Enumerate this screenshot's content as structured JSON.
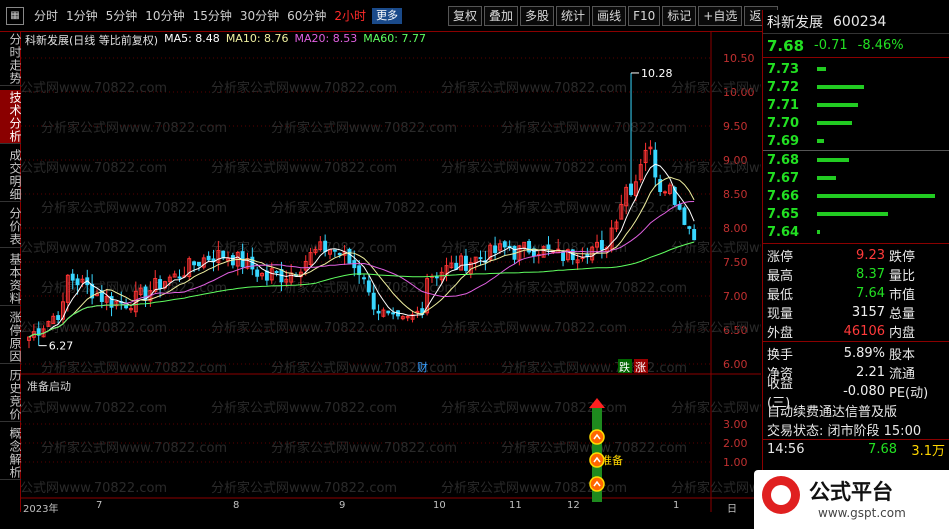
{
  "toolbar": {
    "periods": [
      "分时",
      "1分钟",
      "5分钟",
      "10分钟",
      "15分钟",
      "30分钟",
      "60分钟",
      "2小时"
    ],
    "active_period": "2小时",
    "more": "更多",
    "actions": [
      "复权",
      "叠加",
      "多股",
      "统计",
      "画线",
      "F10",
      "标记",
      "+自选",
      "返回"
    ]
  },
  "vtabs": [
    {
      "label": "分时走势",
      "active": false
    },
    {
      "label": "技术分析",
      "active": true
    },
    {
      "label": "成交明细",
      "active": false
    },
    {
      "label": "分价表",
      "active": false
    },
    {
      "label": "基本资料",
      "active": false
    },
    {
      "label": "涨停原因",
      "active": false
    },
    {
      "label": "历史竞价",
      "active": false
    },
    {
      "label": "概念解析",
      "active": false
    }
  ],
  "chart": {
    "title": "科新发展(日线 等比前复权)",
    "ma5": "MA5: 8.48",
    "ma10": "MA10: 8.76",
    "ma20": "MA20: 8.53",
    "ma60": "MA60: 7.77",
    "high_marker": "10.28",
    "low_marker": "6.27",
    "event_cai": "财",
    "event_die": "跌",
    "event_zhang": "涨",
    "indicator_name": "准备启动",
    "indicator_label": "准备",
    "watermark": "分析家公式网www.70822.com"
  },
  "axis": {
    "price_ticks": [
      "10.50",
      "10.00",
      "9.50",
      "9.00",
      "8.50",
      "8.00",
      "7.50",
      "7.00",
      "6.50",
      "6.00"
    ],
    "ind_ticks": [
      "3.00",
      "2.00",
      "1.00"
    ],
    "dates": [
      "2023年",
      "7",
      "8",
      "9",
      "10",
      "11",
      "12",
      "1"
    ],
    "right_label": "日"
  },
  "quote": {
    "name": "科新发展",
    "code": "600234",
    "price": "7.68",
    "change": "-0.71",
    "change_pct": "-8.46%",
    "asks": [
      {
        "price": "7.73",
        "vol": 0.08
      },
      {
        "price": "7.72",
        "vol": 0.4
      },
      {
        "price": "7.71",
        "vol": 0.35
      },
      {
        "price": "7.70",
        "vol": 0.3
      },
      {
        "price": "7.69",
        "vol": 0.06
      }
    ],
    "bids": [
      {
        "price": "7.68",
        "vol": 0.27
      },
      {
        "price": "7.67",
        "vol": 0.16
      },
      {
        "price": "7.66",
        "vol": 1.0
      },
      {
        "price": "7.65",
        "vol": 0.6
      },
      {
        "price": "7.64",
        "vol": 0.02
      }
    ],
    "stats": [
      {
        "k": "涨停",
        "v": "9.23",
        "vc": "red",
        "k2": "跌停"
      },
      {
        "k": "最高",
        "v": "8.37",
        "vc": "green",
        "k2": "量比"
      },
      {
        "k": "最低",
        "v": "7.64",
        "vc": "green",
        "k2": "市值"
      },
      {
        "k": "现量",
        "v": "3157",
        "vc": "white",
        "k2": "总量"
      },
      {
        "k": "外盘",
        "v": "46106",
        "vc": "red",
        "k2": "内盘"
      }
    ],
    "stats2": [
      {
        "k": "换手",
        "v": "5.89%",
        "vc": "white",
        "k2": "股本"
      },
      {
        "k": "净资",
        "v": "2.21",
        "vc": "white",
        "k2": "流通"
      },
      {
        "k": "收益(三)",
        "v": "-0.080",
        "vc": "white",
        "k2": "PE(动)"
      }
    ],
    "ad_text": "自动续费通达信普及版",
    "status": "交易状态: 闭市阶段 15:00",
    "last_tick": {
      "time": "14:56",
      "price": "7.68",
      "vol": "3.1万"
    }
  },
  "brand": {
    "name": "公式平台",
    "url": "www.gspt.com"
  }
}
